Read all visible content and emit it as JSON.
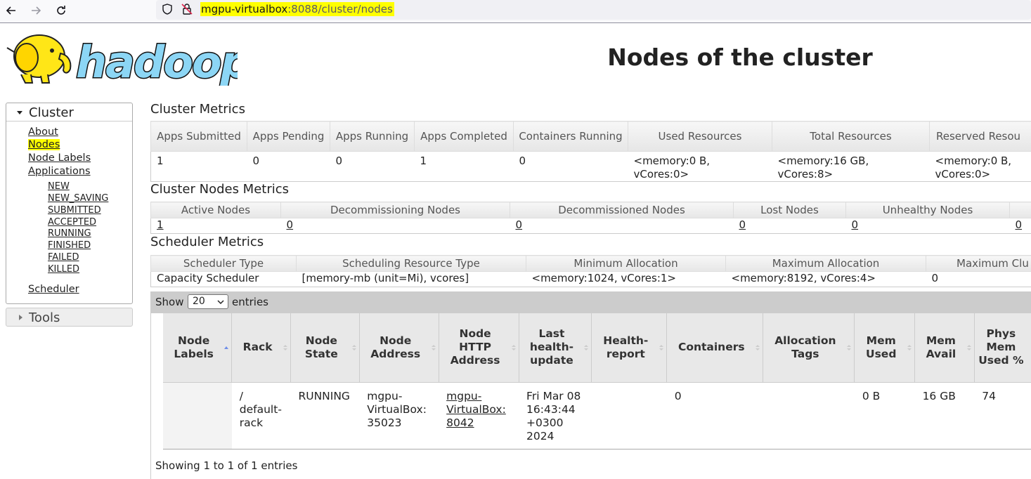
{
  "browser": {
    "url_host": "mgpu-virtualbox",
    "url_rest": ":8088/cluster/nodes"
  },
  "header": {
    "logo_text": "hadoop",
    "title": "Nodes of the cluster"
  },
  "sidebar": {
    "cluster_label": "Cluster",
    "links": [
      "About",
      "Nodes",
      "Node Labels",
      "Applications"
    ],
    "app_states": [
      "NEW",
      "NEW_SAVING",
      "SUBMITTED",
      "ACCEPTED",
      "RUNNING",
      "FINISHED",
      "FAILED",
      "KILLED"
    ],
    "scheduler": "Scheduler",
    "tools_label": "Tools"
  },
  "cluster_metrics": {
    "title": "Cluster Metrics",
    "headers": [
      "Apps Submitted",
      "Apps Pending",
      "Apps Running",
      "Apps Completed",
      "Containers Running",
      "Used Resources",
      "Total Resources",
      "Reserved Resou"
    ],
    "values": [
      "1",
      "0",
      "0",
      "1",
      "0",
      "<memory:0 B, vCores:0>",
      "<memory:16 GB, vCores:8>",
      "<memory:0 B, vCores:0>"
    ]
  },
  "nodes_metrics": {
    "title": "Cluster Nodes Metrics",
    "headers": [
      "Active Nodes",
      "Decommissioning Nodes",
      "Decommissioned Nodes",
      "Lost Nodes",
      "Unhealthy Nodes",
      ""
    ],
    "values": [
      "1",
      "0",
      "0",
      "0",
      "0",
      "0"
    ]
  },
  "scheduler_metrics": {
    "title": "Scheduler Metrics",
    "headers": [
      "Scheduler Type",
      "Scheduling Resource Type",
      "Minimum Allocation",
      "Maximum Allocation",
      "Maximum Clu"
    ],
    "values": [
      "Capacity Scheduler",
      "[memory-mb (unit=Mi), vcores]",
      "<memory:1024, vCores:1>",
      "<memory:8192, vCores:4>",
      "0"
    ]
  },
  "datatable": {
    "show_label": "Show",
    "entries_value": "20",
    "entries_label": "entries",
    "headers": [
      "Node Labels",
      "Rack",
      "Node State",
      "Node Address",
      "Node HTTP Address",
      "Last health-update",
      "Health-report",
      "Containers",
      "Allocation Tags",
      "Mem Used",
      "Mem Avail",
      "Phys Mem Used %"
    ],
    "rows": [
      {
        "node_labels": "",
        "rack": "/ default-rack",
        "state": "RUNNING",
        "address": "mgpu-VirtualBox: 35023",
        "http_address": "mgpu-VirtualBox: 8042",
        "last_update": "Fri Mar 08 16:43:44 +0300 2024",
        "health_report": "",
        "containers": "0",
        "allocation_tags": "",
        "mem_used": "0 B",
        "mem_avail": "16 GB",
        "phys_mem": "74"
      }
    ],
    "info": "Showing 1 to 1 of 1 entries"
  }
}
